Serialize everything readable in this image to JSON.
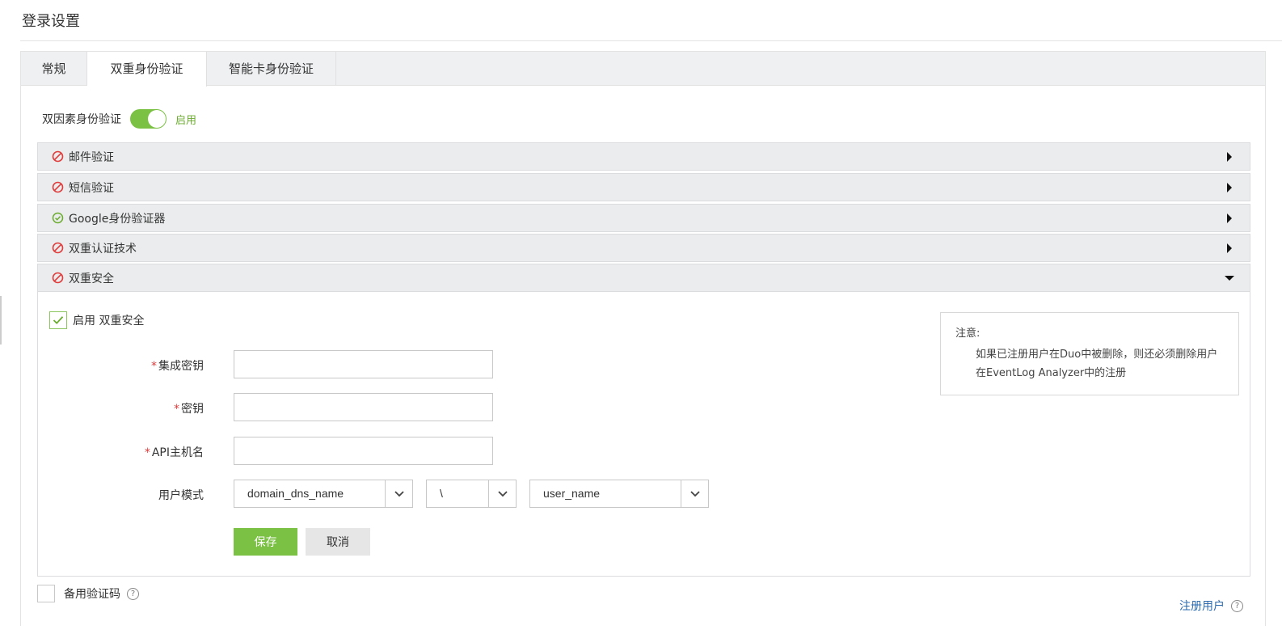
{
  "page": {
    "title": "登录设置"
  },
  "tabs": [
    {
      "label": "常规"
    },
    {
      "label": "双重身份验证"
    },
    {
      "label": "智能卡身份验证"
    }
  ],
  "two_factor": {
    "label": "双因素身份验证",
    "toggle_state": "启用"
  },
  "methods": [
    {
      "label": "邮件验证",
      "status": "disabled",
      "expanded": false
    },
    {
      "label": "短信验证",
      "status": "disabled",
      "expanded": false
    },
    {
      "label": "Google身份验证器",
      "status": "enabled",
      "expanded": false
    },
    {
      "label": "双重认证技术",
      "status": "disabled",
      "expanded": false
    },
    {
      "label": "双重安全",
      "status": "disabled",
      "expanded": true
    }
  ],
  "duo_form": {
    "enable_label": "启用 双重安全",
    "required_mark": "*",
    "integration_key_label": "集成密钥",
    "secret_key_label": "密钥",
    "api_hostname_label": "API主机名",
    "user_pattern_label": "用户模式",
    "integration_key_value": "",
    "secret_key_value": "",
    "api_hostname_value": "",
    "pattern_domain": "domain_dns_name",
    "pattern_separator": "\\",
    "pattern_user": "user_name",
    "save_label": "保存",
    "cancel_label": "取消"
  },
  "note": {
    "title": "注意:",
    "text": "如果已注册用户在Duo中被删除，则还必须删除用户在EventLog Analyzer中的注册"
  },
  "backup": {
    "label": "备用验证码",
    "help": "?"
  },
  "register": {
    "label": "注册用户",
    "help": "?"
  },
  "colors": {
    "accent_green": "#7bc144",
    "error_red": "#e03c3c",
    "success_green": "#6aab2e",
    "link_blue": "#2b6cb0"
  }
}
